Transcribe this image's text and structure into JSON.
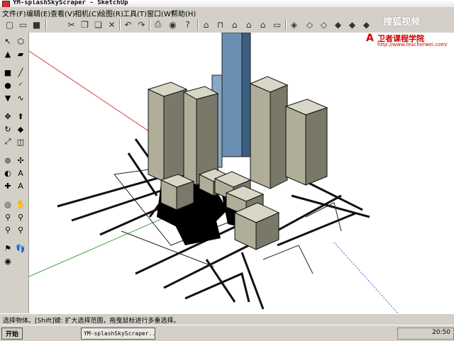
{
  "window": {
    "title": "YM-splashSkyScraper - SketchUp"
  },
  "menu": [
    "文件(F)",
    "编辑(E)",
    "查看(V)",
    "相机(C)",
    "绘图(R)",
    "工具(T)",
    "窗口(W)",
    "帮助(H)"
  ],
  "toolbar_icons": [
    "new-icon",
    "open-icon",
    "save-icon",
    "cut-icon",
    "copy-icon",
    "paste-icon",
    "erase-icon",
    "undo-icon",
    "redo-icon",
    "print-icon",
    "help-icon",
    "house-icon",
    "front-view-icon",
    "iso-view-icon",
    "top-view-icon",
    "house-outline-icon",
    "xray-icon",
    "wireframe-icon",
    "hidden-line-icon",
    "shaded-icon",
    "textured-icon",
    "monochrome-icon"
  ],
  "left_tools": [
    "select-icon",
    "component-icon",
    "paint-icon",
    "eraser-icon",
    "rectangle-icon",
    "line-icon",
    "circle-icon",
    "arc-icon",
    "polygon-icon",
    "freehand-icon",
    "move-icon",
    "pushpull-icon",
    "rotate-icon",
    "followme-icon",
    "scale-icon",
    "offset-icon",
    "tape-icon",
    "dimension-icon",
    "protractor-icon",
    "text-icon",
    "axes-icon",
    "3dtext-icon",
    "orbit-icon",
    "pan-icon",
    "zoom-icon",
    "zoom-window-icon",
    "zoom-previous-icon",
    "zoom-extents-icon",
    "walk-icon",
    "position-camera-icon",
    "look-around-icon"
  ],
  "watermark": "搜狐视频",
  "brand": {
    "name": "卫者课程学院",
    "url": "http://www.teacherwei.com/"
  },
  "status": {
    "text": "选择物体。[Shift]键: 扩大选择范围，拖曳鼠标进行多重选择。"
  },
  "taskbar": {
    "start": "开始",
    "task": "YM-splashSkyScraper...",
    "clock": "20:50"
  },
  "colors": {
    "building": "#b0ad99",
    "shadow": "#000000",
    "tower_glass": "#6b8fb0"
  }
}
